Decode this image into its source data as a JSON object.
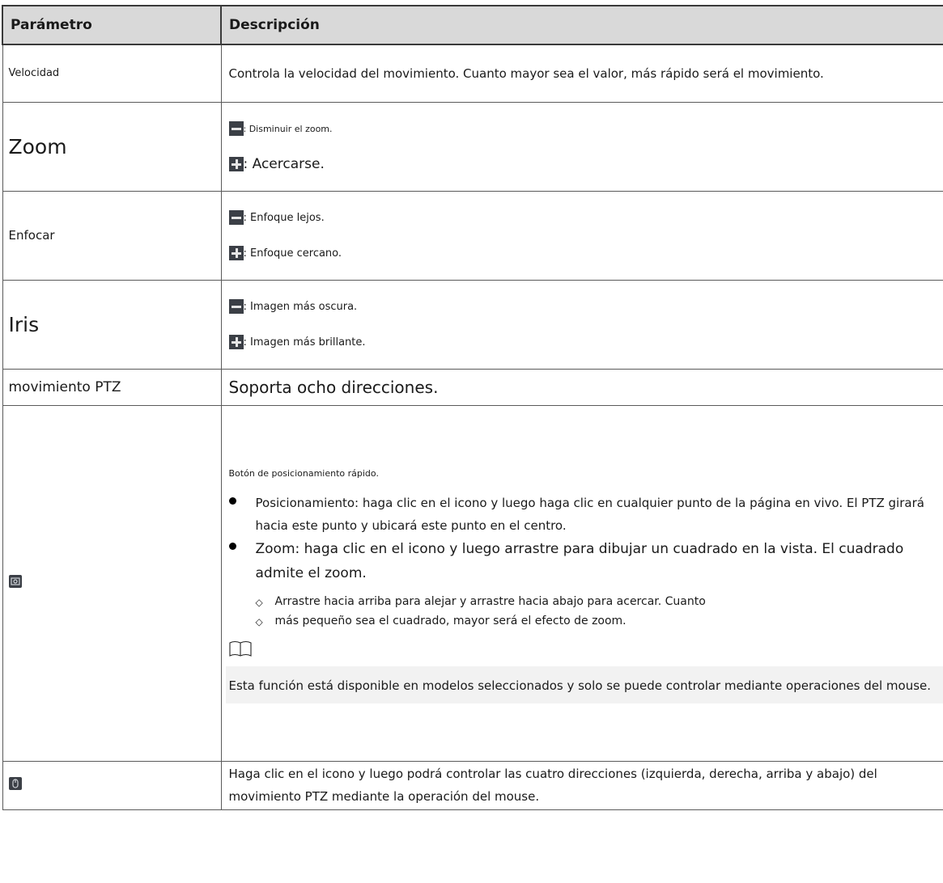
{
  "table": {
    "header": {
      "param": "Parámetro",
      "desc": "Descripción"
    },
    "velocidad": {
      "param": "Velocidad",
      "desc": "Controla la velocidad del movimiento. Cuanto mayor sea el valor, más rápido será el movimiento."
    },
    "zoom": {
      "param": "Zoom",
      "minus": ": Disminuir el zoom.",
      "plus": ": Acercarse."
    },
    "enfocar": {
      "param": "Enfocar",
      "minus": ": Enfoque lejos.",
      "plus": ": Enfoque cercano."
    },
    "iris": {
      "param": "Iris",
      "minus": ": Imagen más oscura.",
      "plus": ": Imagen más brillante."
    },
    "ptz": {
      "param": "movimiento PTZ",
      "desc": "Soporta ocho direcciones."
    },
    "quick": {
      "icon": "quick-position-icon",
      "title": "Botón de posicionamiento rápido.",
      "bullet1": "Posicionamiento: haga clic en el icono y luego haga clic en cualquier punto de la página en vivo. El PTZ girará hacia este punto y ubicará este punto en el centro.",
      "bullet2": "Zoom: haga clic en el icono y luego arrastre para dibujar un cuadrado en la vista. El cuadrado admite el zoom.",
      "sub1": "Arrastre hacia arriba para alejar y arrastre hacia abajo para acercar. Cuanto",
      "sub2": "más pequeño sea el cuadrado, mayor será el efecto de zoom.",
      "note_icon": "book-note-icon",
      "note": "Esta función está disponible en modelos seleccionados y solo se puede controlar mediante operaciones del mouse."
    },
    "mouse": {
      "icon": "mouse-icon",
      "desc": "Haga clic en el icono y luego podrá controlar las cuatro direcciones (izquierda, derecha, arriba y abajo) del movimiento PTZ mediante la operación del mouse."
    }
  }
}
